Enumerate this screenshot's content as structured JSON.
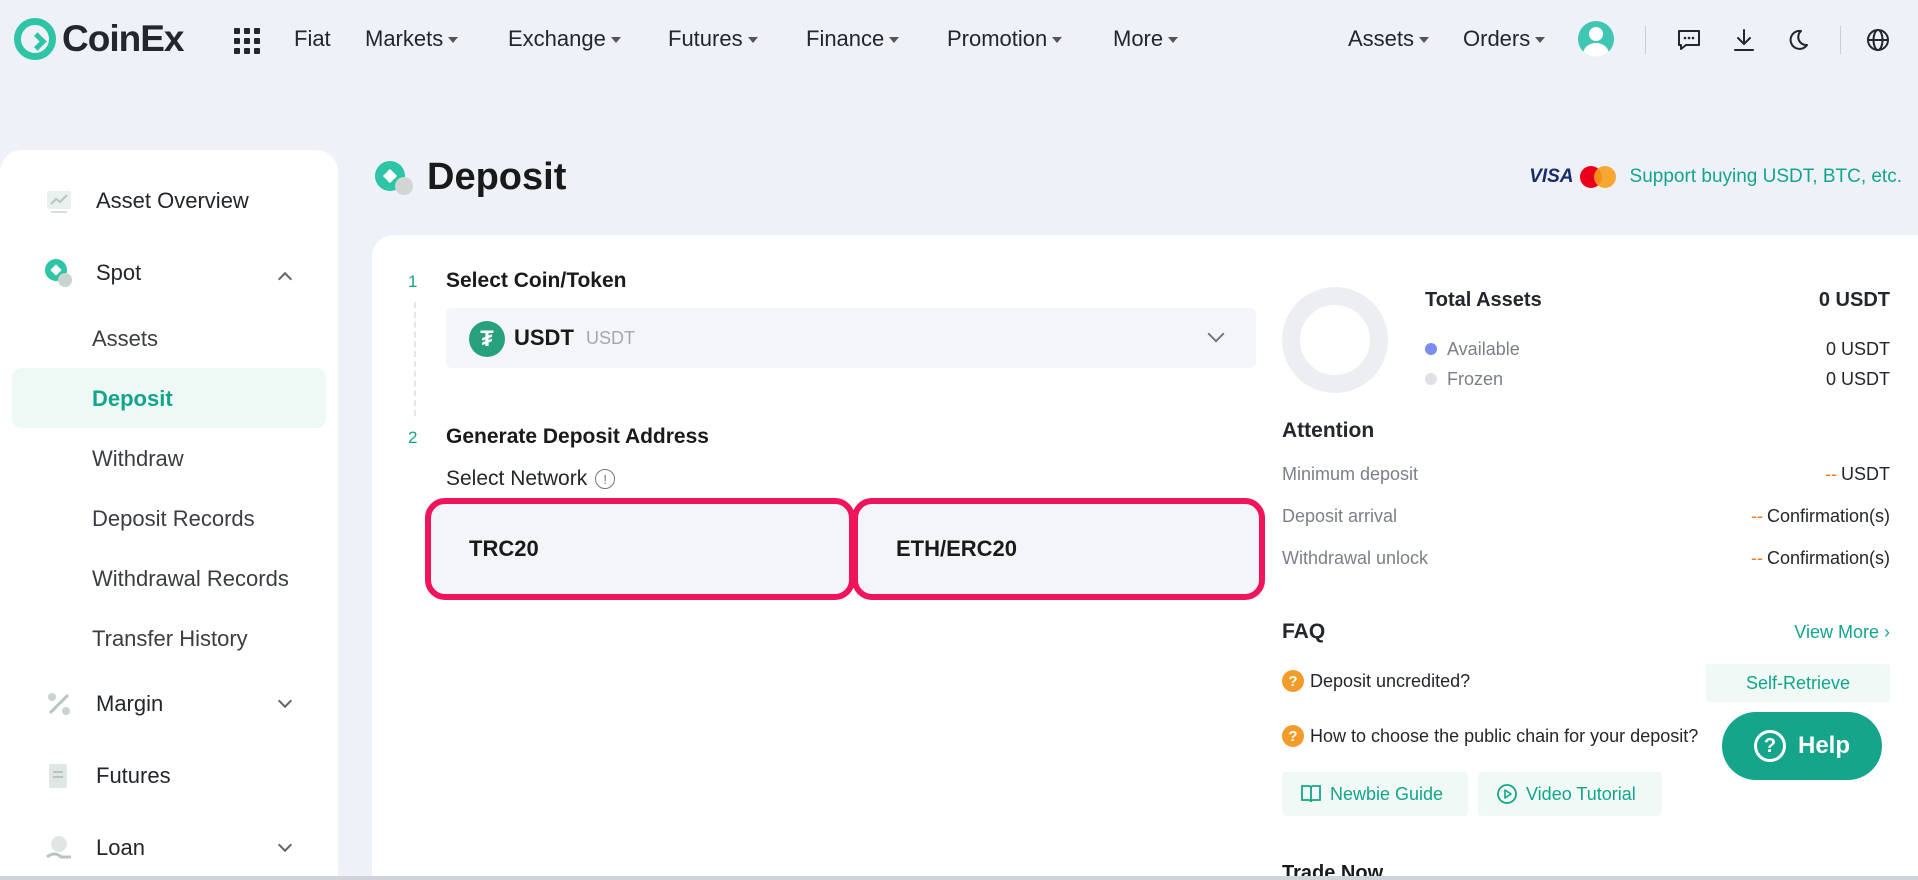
{
  "brand": {
    "name": "CoinEx",
    "accent": "#12a58b",
    "highlight": "#f0145a"
  },
  "topnav": {
    "items": [
      {
        "label": "Fiat",
        "dropdown": false
      },
      {
        "label": "Markets",
        "dropdown": true
      },
      {
        "label": "Exchange",
        "dropdown": true
      },
      {
        "label": "Futures",
        "dropdown": true
      },
      {
        "label": "Finance",
        "dropdown": true
      },
      {
        "label": "Promotion",
        "dropdown": true
      },
      {
        "label": "More",
        "dropdown": true
      }
    ],
    "assets_label": "Assets",
    "orders_label": "Orders"
  },
  "sidebar": {
    "asset_overview": "Asset Overview",
    "spot": "Spot",
    "spot_items": [
      "Assets",
      "Deposit",
      "Withdraw",
      "Deposit Records",
      "Withdrawal Records",
      "Transfer History"
    ],
    "active_item": "Deposit",
    "margin": "Margin",
    "futures": "Futures",
    "loan": "Loan"
  },
  "page": {
    "title": "Deposit",
    "visa": "VISA",
    "support_text": "Support buying USDT, BTC, etc."
  },
  "form": {
    "step1_num": "1",
    "step1_title": "Select Coin/Token",
    "coin_symbol": "USDT",
    "coin_name": "USDT",
    "step2_num": "2",
    "step2_title": "Generate Deposit Address",
    "network_label": "Select Network",
    "networks": [
      "TRC20",
      "ETH/ERC20"
    ]
  },
  "assets": {
    "total_label": "Total Assets",
    "total_value": "0 USDT",
    "available_label": "Available",
    "available_value": "0 USDT",
    "frozen_label": "Frozen",
    "frozen_value": "0 USDT"
  },
  "attention": {
    "title": "Attention",
    "rows": [
      {
        "label": "Minimum deposit",
        "dash": "--",
        "value": "USDT"
      },
      {
        "label": "Deposit arrival",
        "dash": "--",
        "value": "Confirmation(s)"
      },
      {
        "label": "Withdrawal unlock",
        "dash": "--",
        "value": "Confirmation(s)"
      }
    ]
  },
  "faq": {
    "title": "FAQ",
    "view_more": "View More",
    "q1": "Deposit uncredited?",
    "self_retrieve": "Self-Retrieve",
    "q2": "How to choose the public chain for your deposit?",
    "newbie_guide": "Newbie Guide",
    "video_tutorial": "Video Tutorial"
  },
  "help_label": "Help",
  "trade_now": "Trade Now"
}
